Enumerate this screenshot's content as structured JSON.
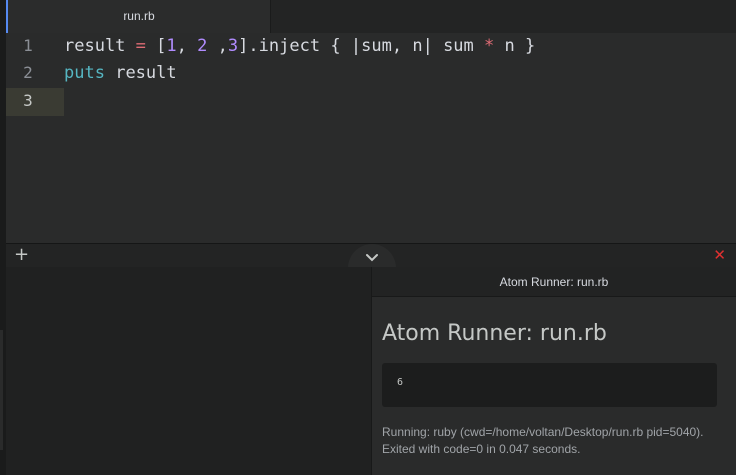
{
  "tabs": [
    {
      "title": "run.rb",
      "active": true
    }
  ],
  "editor": {
    "lines": [
      {
        "number": "1",
        "text": "result = [1, 2 ,3].inject { |sum, n| sum * n }"
      },
      {
        "number": "2",
        "text": "puts result"
      },
      {
        "number": "3",
        "text": ""
      }
    ],
    "cursor_line": 3
  },
  "panel_toolbar": {
    "add_label": "+",
    "collapse_icon": "chevron-down-icon",
    "close_label": "✕"
  },
  "runner": {
    "header_title": "Atom Runner: run.rb",
    "heading": "Atom Runner: run.rb",
    "output": "6",
    "status_line1": "Running: ruby (cwd=/home/voltan/Desktop/run.rb pid=5040).",
    "status_line2": "Exited with code=0 in 0.047 seconds."
  },
  "colors": {
    "accent": "#568af2",
    "close": "#e03030",
    "operator": "#e06c75",
    "number": "#b18cff",
    "builtin": "#56b6c2"
  }
}
